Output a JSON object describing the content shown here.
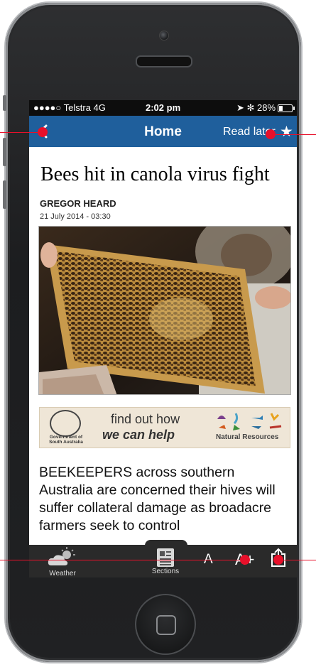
{
  "status_bar": {
    "carrier": "●●●●○ Telstra  4G",
    "time": "2:02 pm",
    "indicators": "➤ ✻ 28%",
    "battery_percent": 28
  },
  "nav": {
    "back_icon": "back-chevron-icon",
    "title": "Home",
    "read_later": "Read later",
    "star_icon": "star-icon"
  },
  "article": {
    "headline": "Bees hit in canola virus fight",
    "author": "GREGOR HEARD",
    "date": "21 July 2014 - 03:30",
    "body": "BEEKEEPERS across southern Australia are concerned their hives will suffer collateral damage as broadacre farmers seek to control"
  },
  "ad": {
    "gov_label": "Government of South Australia",
    "line1": "find out how",
    "line2": "we can help",
    "brand": "Natural Resources"
  },
  "tabbar": {
    "weather_label": "Weather",
    "sections_label": "Sections",
    "font_small": "A",
    "font_large": "A+",
    "share_icon": "share-icon"
  },
  "colors": {
    "nav_blue": "#1f5f9c",
    "marker_red": "#e8102a"
  }
}
